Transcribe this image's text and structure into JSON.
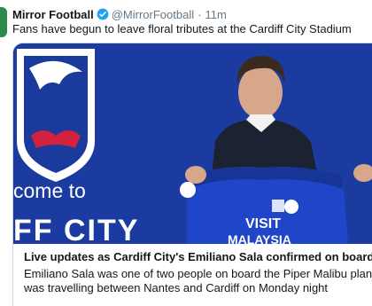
{
  "tweet": {
    "author_name": "Mirror Football",
    "verified": true,
    "handle": "@MirrorFootball",
    "separator": "·",
    "time": "11m",
    "text": "Fans have begun to leave floral tributes at the Cardiff City Stadium"
  },
  "card": {
    "image_text": {
      "banner_line1": "come to",
      "banner_line2": "FF CITY",
      "shirt_sponsor_line1": "VISIT",
      "shirt_sponsor_line2": "MALAYSIA"
    },
    "title": "Live updates as Cardiff City's Emiliano Sala confirmed on board mi",
    "description_line1": "Emiliano Sala was one of two people on board the Piper Malibu plane w",
    "description_line2": "was travelling between Nantes and Cardiff on Monday night"
  },
  "colors": {
    "cardiff_blue": "#1a3a9c",
    "twitter_blue": "#1da1f2",
    "text_primary": "#14171a",
    "text_secondary": "#657786"
  }
}
